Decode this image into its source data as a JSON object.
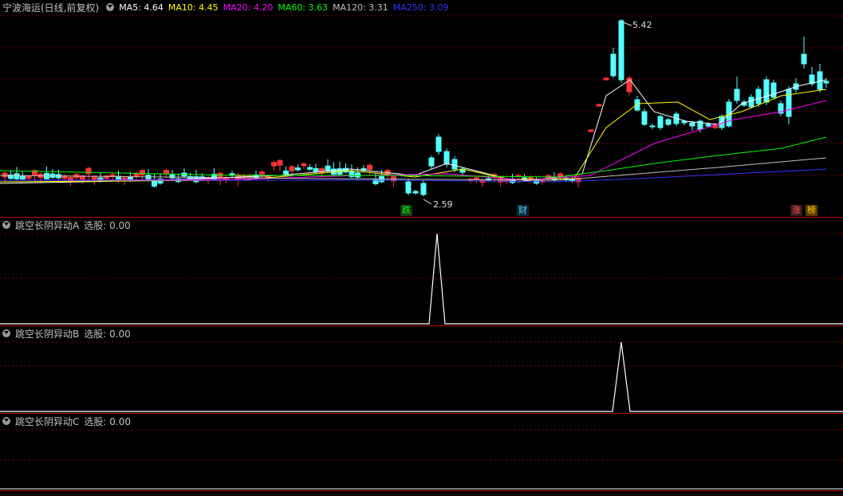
{
  "main": {
    "stock_title": "宁波海运(日线,前复权)",
    "ma_indicators": [
      {
        "label": "MA5: 4.64",
        "color": "#ffffff"
      },
      {
        "label": "MA10: 4.45",
        "color": "#ffff00"
      },
      {
        "label": "MA20: 4.20",
        "color": "#ff00ff"
      },
      {
        "label": "MA60: 3.63",
        "color": "#00ff00"
      },
      {
        "label": "MA120: 3.31",
        "color": "#c0c0c0"
      },
      {
        "label": "MA250: 3.09",
        "color": "#3333ff"
      }
    ],
    "high_label": "5.42",
    "low_label": "2.59",
    "badges": [
      {
        "text": "跌",
        "color": "#00ff00",
        "bg": "#1a3a1a"
      },
      {
        "text": "财",
        "color": "#66ccff",
        "bg": "#0a2a3a"
      },
      {
        "text": "涨",
        "color": "#ff5555",
        "bg": "#3a1a1a"
      },
      {
        "text": "榜",
        "color": "#ffcc00",
        "bg": "#5a3a00"
      }
    ]
  },
  "indicators": [
    {
      "title": "跳空长阴异动A",
      "value_label": "选股: 0.00"
    },
    {
      "title": "跳空长阴异动B",
      "value_label": "选股: 0.00"
    },
    {
      "title": "跳空长阴异动C",
      "value_label": "选股: 0.00"
    }
  ],
  "colors": {
    "up": "#ff3333",
    "down": "#54ffff",
    "grid": "#800000",
    "border": "#b00000"
  }
}
